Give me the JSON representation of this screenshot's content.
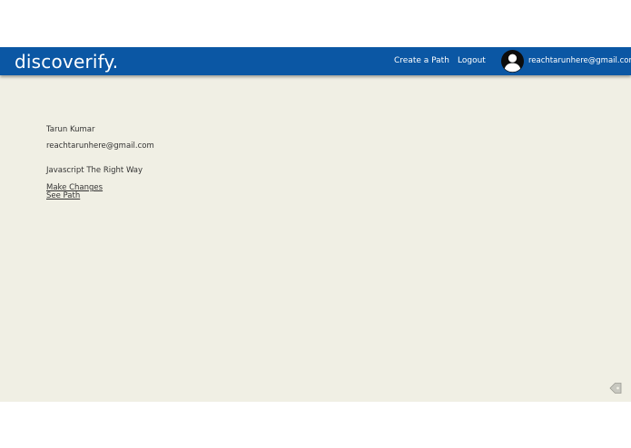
{
  "header": {
    "logo": "discoverify.",
    "nav": {
      "create_path": "Create a Path",
      "logout": "Logout"
    },
    "user_email": "reachtarunhere@gmail.com",
    "avatar_icon": "user-avatar-icon",
    "bar_color": "#0b57a4"
  },
  "profile": {
    "name": "Tarun Kumar",
    "email": "reachtarunhere@gmail.com",
    "path_title": "Javascript The Right Way",
    "make_changes": "Make Changes ",
    "see_path": "See Path "
  },
  "corner": {
    "icon": "tag-icon"
  },
  "colors": {
    "content_bg": "#f0efe4",
    "text": "#333333"
  }
}
